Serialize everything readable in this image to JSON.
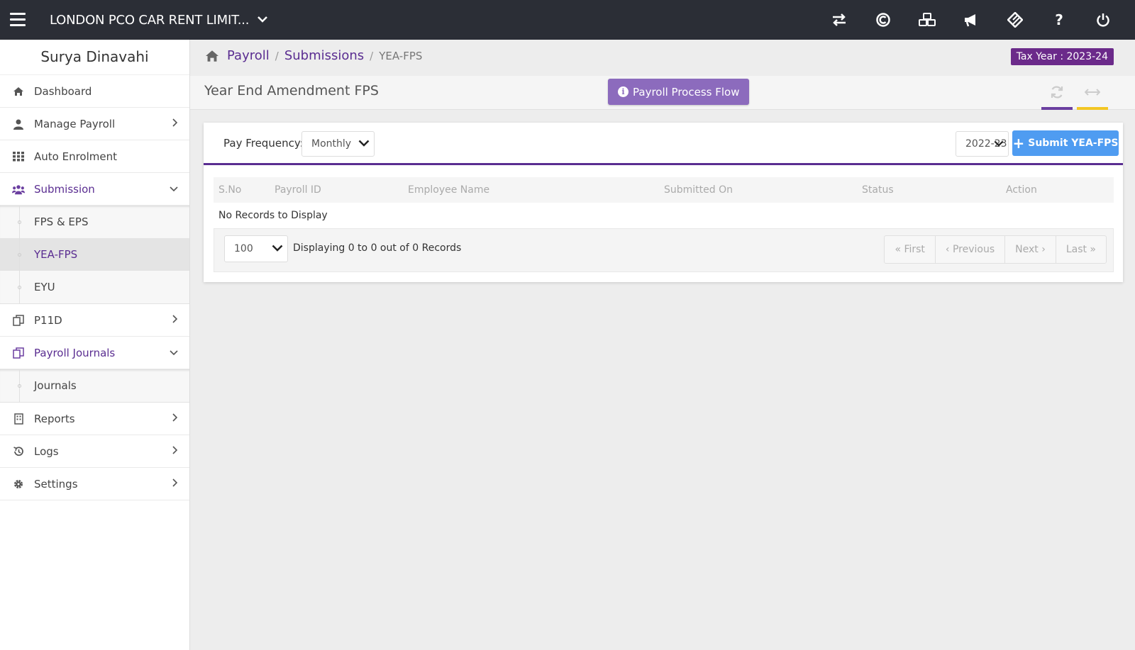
{
  "topbar": {
    "company": "LONDON PCO CAR RENT LIMIT...",
    "icons": [
      "switch-icon",
      "copyright-icon",
      "cubes-icon",
      "megaphone-icon",
      "ticket-icon",
      "help-icon",
      "power-icon"
    ],
    "help_glyph": "?"
  },
  "sidebar": {
    "user_name": "Surya Dinavahi",
    "items": [
      {
        "label": "Dashboard"
      },
      {
        "label": "Manage Payroll"
      },
      {
        "label": "Auto Enrolment"
      },
      {
        "label": "Submission"
      },
      {
        "label": "P11D"
      },
      {
        "label": "Payroll Journals"
      },
      {
        "label": "Reports"
      },
      {
        "label": "Logs"
      },
      {
        "label": "Settings"
      }
    ],
    "submission_sub": [
      {
        "label": "FPS & EPS"
      },
      {
        "label": "YEA-FPS"
      },
      {
        "label": "EYU"
      }
    ],
    "journals_sub": [
      {
        "label": "Journals"
      }
    ]
  },
  "breadcrumb": {
    "items": [
      "Payroll",
      "Submissions"
    ],
    "current": "YEA-FPS",
    "separator": "/"
  },
  "tax_year": "Tax Year : 2023-24",
  "page": {
    "title": "Year End Amendment FPS",
    "flow_button": "Payroll Process Flow"
  },
  "filters": {
    "pay_frequency_label": "Pay Frequency:",
    "pay_frequency_value": "Monthly",
    "year_value": "2022-23",
    "submit_label": "Submit YEA-FPS"
  },
  "table": {
    "columns": [
      "S.No",
      "Payroll ID",
      "Employee Name",
      "Submitted On",
      "Status",
      "Action"
    ],
    "empty_text": "No Records to Display"
  },
  "pagination": {
    "page_size": "100",
    "display_text": "Displaying 0 to 0 out of 0 Records",
    "first": "« First",
    "previous": "‹ Previous",
    "next": "Next ›",
    "last": "Last »"
  },
  "colors": {
    "topbar": "#2b2e36",
    "brand_purple": "#5a2d91",
    "flow_button": "#8c6bbd",
    "submit_button": "#4f9cf1",
    "tax_badge": "#6b2a8a",
    "accent_yellow": "#f3c623"
  }
}
